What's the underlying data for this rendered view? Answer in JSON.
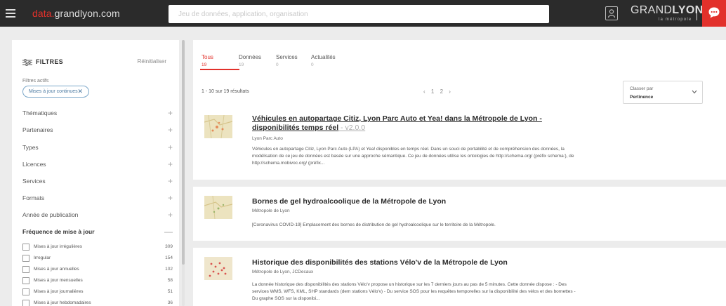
{
  "header": {
    "brand_accent": "data.",
    "brand_rest": "grandlyon.com",
    "search_placeholder": "Jeu de données, application, organisation",
    "logo_word_light": "GRAND",
    "logo_word_bold": "LYON",
    "logo_sub": "la métropole",
    "accent_color": "#e2312b"
  },
  "filters": {
    "title": "FILTRES",
    "reset": "Réinitialiser",
    "active_label": "Filtres actifs",
    "active_chip": "Mises à jour continues",
    "chip_close": "✕",
    "plus": "+",
    "minus": "—",
    "categories": [
      {
        "label": "Thématiques"
      },
      {
        "label": "Partenaires"
      },
      {
        "label": "Types"
      },
      {
        "label": "Licences"
      },
      {
        "label": "Services"
      },
      {
        "label": "Formats"
      },
      {
        "label": "Année de publication"
      }
    ],
    "open_category": "Fréquence de mise à jour",
    "options": [
      {
        "label": "Mises à jour irrégulières",
        "count": "309"
      },
      {
        "label": "Irregular",
        "count": "154"
      },
      {
        "label": "Mises à jour annuelles",
        "count": "102"
      },
      {
        "label": "Mises à jour mensuelles",
        "count": "58"
      },
      {
        "label": "Mises à jour journalières",
        "count": "51"
      },
      {
        "label": "Mises à jour hebdomadaires",
        "count": "36"
      }
    ]
  },
  "tabs": [
    {
      "label": "Tous",
      "count": "19"
    },
    {
      "label": "Données",
      "count": "19"
    },
    {
      "label": "Services",
      "count": "0"
    },
    {
      "label": "Actualités",
      "count": "0"
    }
  ],
  "results_header": {
    "count_text": "1 - 10 sur 19 résultats",
    "pager_prev": "‹",
    "pager_pages": [
      "1",
      "2"
    ],
    "pager_next": "›",
    "sort_label": "Classer par",
    "sort_value": "Pertinence"
  },
  "results": [
    {
      "title": "Véhicules en autopartage Citiz, Lyon Parc Auto et Yea! dans la Métropole de Lyon - disponibilités temps réel",
      "version": "  - v2.0.0",
      "org": "Lyon Parc Auto",
      "desc": "Véhicules en autopartage Citiz, Lyon Parc Auto (LPA) et Yea! disponibles en temps réel. Dans un souci de portabilité et de compréhension des données, la modélisation de ce jeu de données est basée sur une approche sémantique. Ce jeu de données utilise les ontologies de http://schema.org/ (préfix schema:), de http://schema.mobivoc.org/ (préfix..."
    },
    {
      "title": "Bornes de gel hydroalcoolique de la Métropole de Lyon",
      "version": "",
      "org": "Métropole de Lyon",
      "desc": "[Coronavirus COVID-19] Emplacement des bornes de distribution de gel hydroalcoolique sur le territoire de la Métropole."
    },
    {
      "title": "Historique des disponibilités des stations Vélo'v de la Métropole de Lyon",
      "version": "",
      "org": "Métropole de Lyon, JCDecaux",
      "desc": "La donnée historique des disponibilités des stations Vélo'v propose un historique sur les 7 derniers jours au pas de 5 minutes. Cette donnée dispose : - Des services WMS, WFS, KML, SHP standards (dem stations Vélo'v) - Du service SOS pour les requêtes temporelles sur la disponibilité des vélos et des bornettes - Du graphe SOS sur la disponibi..."
    }
  ]
}
